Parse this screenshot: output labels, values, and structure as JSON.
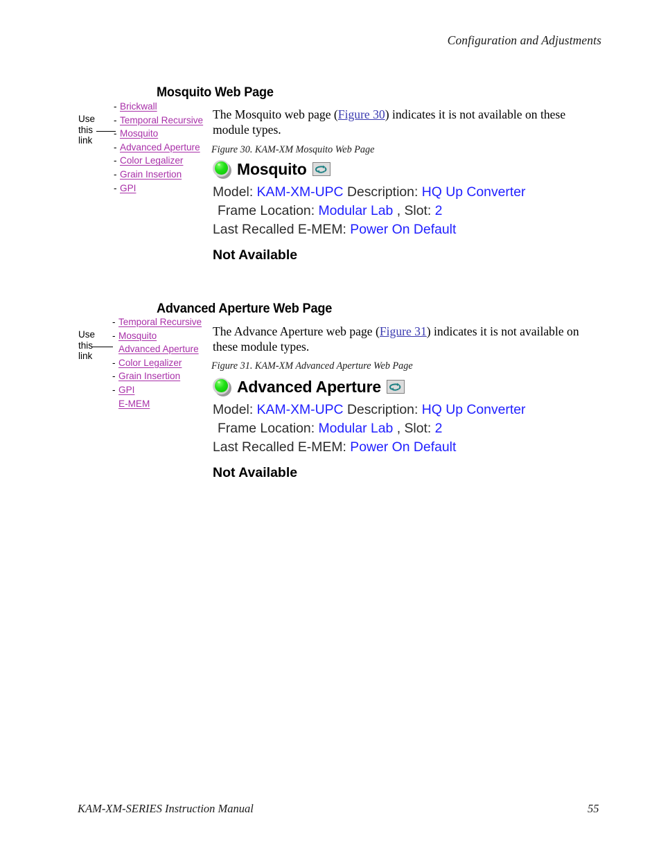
{
  "page": {
    "running_header": "Configuration and Adjustments",
    "footer_title": "KAM-XM-SERIES Instruction Manual",
    "footer_page_number": "55"
  },
  "colors": {
    "nav_link": "#a82fa8",
    "figure_reference_link": "#3a3ab0",
    "webpage_value_blue": "#2020ff",
    "led_green": "#22e017",
    "refresh_icon_teal": "#1b7f82"
  },
  "sections": [
    {
      "heading": "Mosquito Web Page",
      "callout": {
        "line1": "Use",
        "line2": "this",
        "line3": "link"
      },
      "nav_items": [
        {
          "dash": "-",
          "label": "Brickwall"
        },
        {
          "dash": "-",
          "label": "Temporal Recursive"
        },
        {
          "dash": "-",
          "label": "Mosquito"
        },
        {
          "dash": "-",
          "label": "Advanced Aperture"
        },
        {
          "dash": "-",
          "label": "Color Legalizer"
        },
        {
          "dash": "-",
          "label": "Grain Insertion"
        },
        {
          "dash": "-",
          "label": "GPI"
        }
      ],
      "paragraph": {
        "before": "The Mosquito web page (",
        "link": "Figure 30",
        "after": ") indicates it is not available on these module types."
      },
      "figure_caption": "Figure 30.  KAM-XM Mosquito Web Page",
      "webpage": {
        "status_led": "green-led-icon",
        "title": "Mosquito",
        "refresh_icon": "refresh-icon",
        "model_label": "Model:",
        "model_value": "KAM-XM-UPC",
        "description_label": "Description:",
        "description_value": "HQ Up Converter",
        "frame_location_label": "Frame Location:",
        "frame_location_value": "Modular Lab",
        "slot_label": ", Slot:",
        "slot_value": "2",
        "last_recalled_label": "Last Recalled E-MEM:",
        "last_recalled_value": "Power On Default",
        "status_text": "Not Available"
      }
    },
    {
      "heading": "Advanced Aperture Web Page",
      "callout": {
        "line1": "Use",
        "line2": "this",
        "line3": "link"
      },
      "nav_items": [
        {
          "dash": "-",
          "label": "Temporal Recursive"
        },
        {
          "dash": "-",
          "label": "Mosquito"
        },
        {
          "dash": "",
          "label": "Advanced Aperture"
        },
        {
          "dash": "-",
          "label": "Color Legalizer"
        },
        {
          "dash": "-",
          "label": "Grain Insertion"
        },
        {
          "dash": "-",
          "label": "GPI"
        },
        {
          "dash": "",
          "label": "E-MEM"
        }
      ],
      "paragraph": {
        "before": "The Advance Aperture web page (",
        "link": "Figure 31",
        "after": ") indicates it is not available on these module types."
      },
      "figure_caption": "Figure 31.  KAM-XM Advanced Aperture Web Page",
      "webpage": {
        "status_led": "green-led-icon",
        "title": "Advanced Aperture",
        "refresh_icon": "refresh-icon",
        "model_label": "Model:",
        "model_value": "KAM-XM-UPC",
        "description_label": "Description:",
        "description_value": "HQ Up Converter",
        "frame_location_label": "Frame Location:",
        "frame_location_value": "Modular Lab",
        "slot_label": ", Slot:",
        "slot_value": "2",
        "last_recalled_label": "Last Recalled E-MEM:",
        "last_recalled_value": "Power On Default",
        "status_text": "Not Available"
      }
    }
  ]
}
